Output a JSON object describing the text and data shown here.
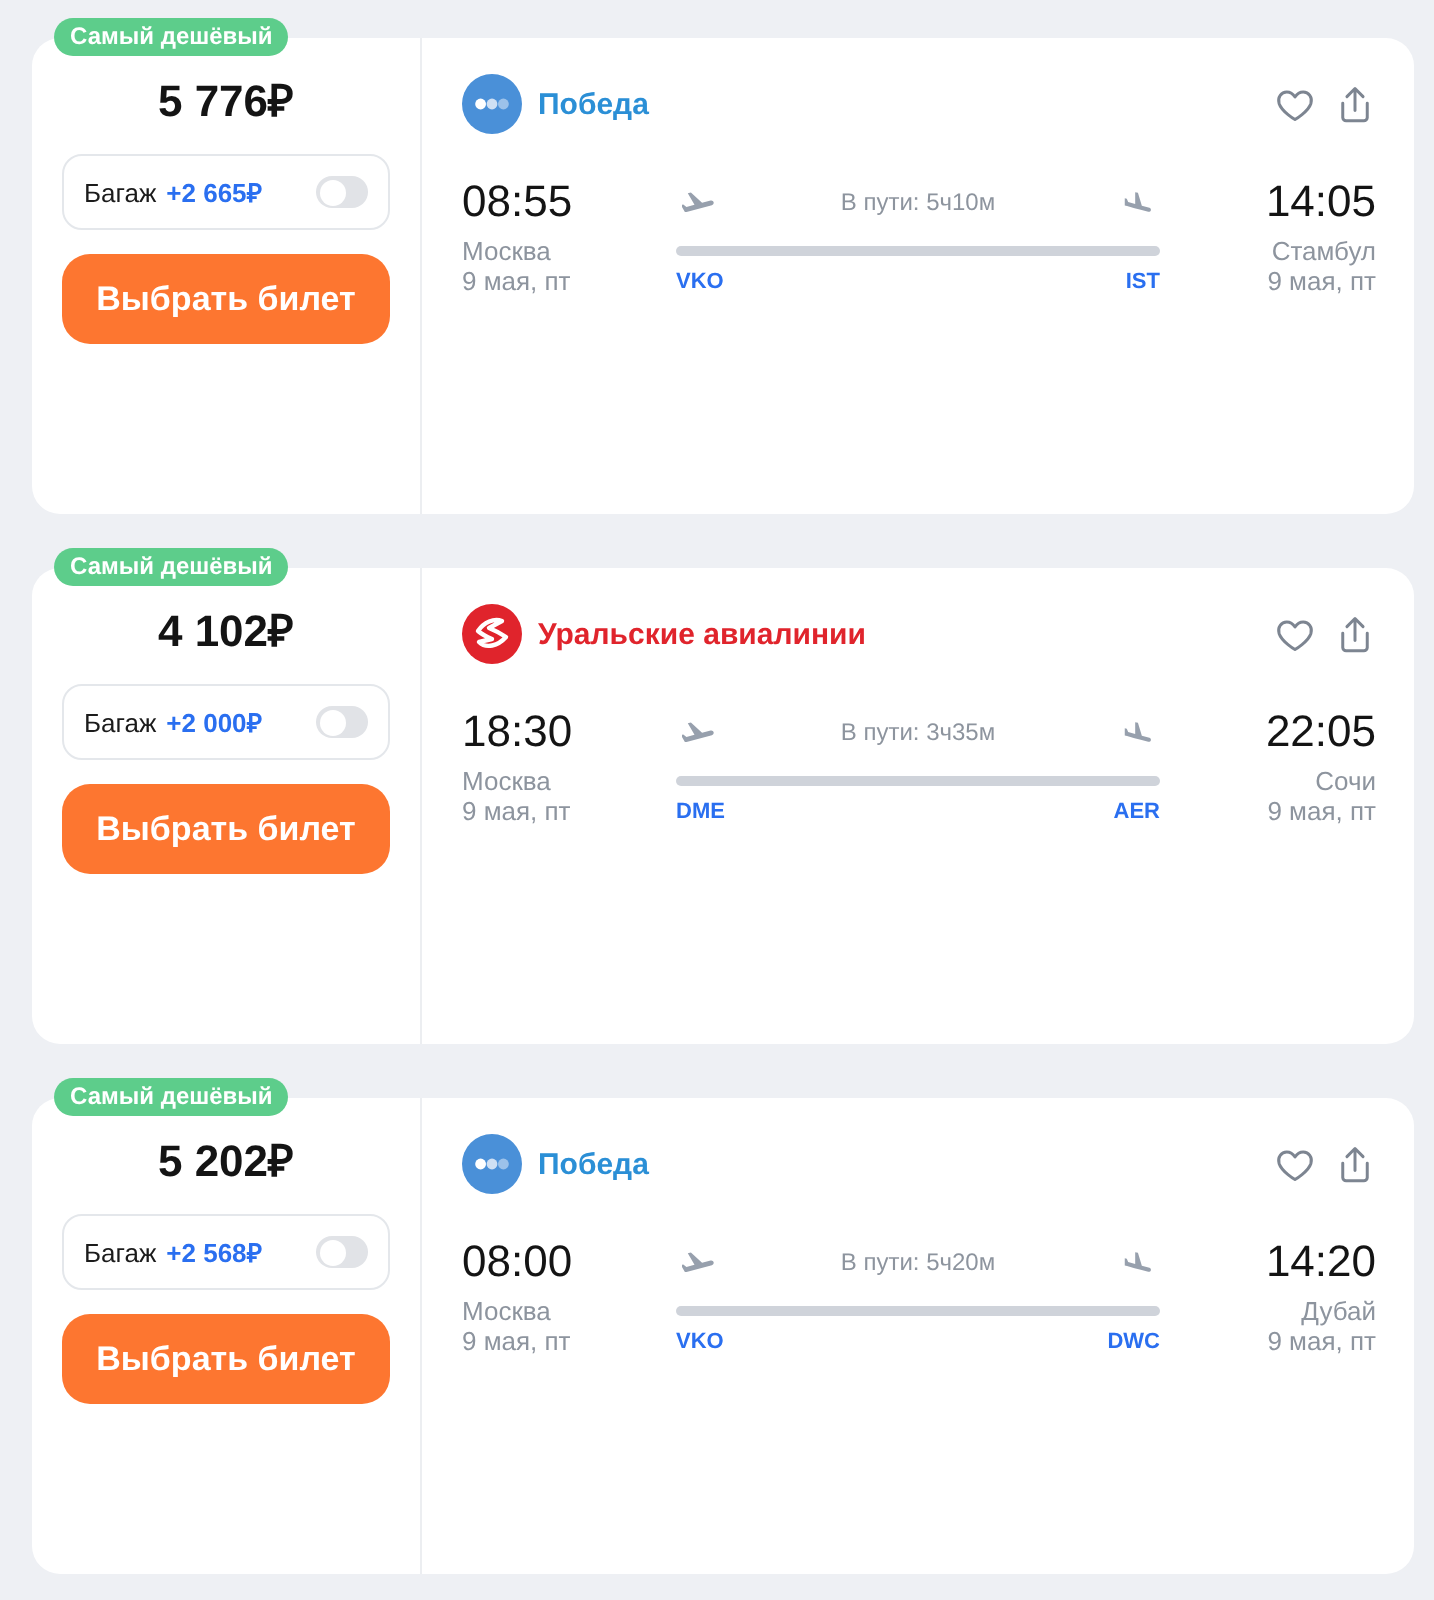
{
  "flights": [
    {
      "badge": "Самый дешёвый",
      "price": "5 776₽",
      "baggage": {
        "label": "Багаж",
        "price": "+2 665₽",
        "on": false
      },
      "button": "Выбрать билет",
      "airline": {
        "name": "Победа",
        "kind": "pobeda"
      },
      "departure": {
        "time": "08:55",
        "city": "Москва",
        "date": "9 мая, пт",
        "airport": "VKO"
      },
      "duration": "В пути: 5ч10м",
      "arrival": {
        "time": "14:05",
        "city": "Стамбул",
        "date": "9 мая, пт",
        "airport": "IST"
      }
    },
    {
      "badge": "Самый дешёвый",
      "price": "4 102₽",
      "baggage": {
        "label": "Багаж",
        "price": "+2 000₽",
        "on": false
      },
      "button": "Выбрать билет",
      "airline": {
        "name": "Уральские авиалинии",
        "kind": "ural"
      },
      "departure": {
        "time": "18:30",
        "city": "Москва",
        "date": "9 мая, пт",
        "airport": "DME"
      },
      "duration": "В пути: 3ч35м",
      "arrival": {
        "time": "22:05",
        "city": "Сочи",
        "date": "9 мая, пт",
        "airport": "AER"
      }
    },
    {
      "badge": "Самый дешёвый",
      "price": "5 202₽",
      "baggage": {
        "label": "Багаж",
        "price": "+2 568₽",
        "on": false
      },
      "button": "Выбрать билет",
      "airline": {
        "name": "Победа",
        "kind": "pobeda"
      },
      "departure": {
        "time": "08:00",
        "city": "Москва",
        "date": "9 мая, пт",
        "airport": "VKO"
      },
      "duration": "В пути: 5ч20м",
      "arrival": {
        "time": "14:20",
        "city": "Дубай",
        "date": "9 мая, пт",
        "airport": "DWC"
      }
    }
  ]
}
